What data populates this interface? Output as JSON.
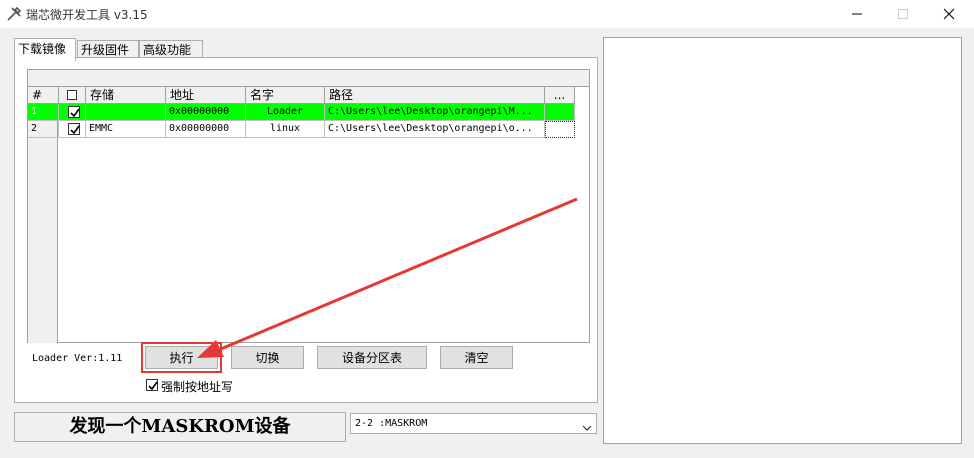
{
  "window": {
    "title": "瑞芯微开发工具 v3.15",
    "icon": "tools-icon"
  },
  "tabs": [
    {
      "label": "下载镜像",
      "active": true
    },
    {
      "label": "升级固件",
      "active": false
    },
    {
      "label": "高级功能",
      "active": false
    }
  ],
  "table": {
    "headers": {
      "num": "#",
      "check": "",
      "storage": "存储",
      "address": "地址",
      "name": "名字",
      "path": "路径",
      "more": "..."
    },
    "rows": [
      {
        "num": "1",
        "checked": true,
        "storage": "",
        "address": "0x00000000",
        "name": "Loader",
        "path": "C:\\Users\\lee\\Desktop\\orangepi\\M...",
        "more": ""
      },
      {
        "num": "2",
        "checked": true,
        "storage": "EMMC",
        "address": "0x00000000",
        "name": "linux",
        "path": "C:\\Users\\lee\\Desktop\\orangepi\\o...",
        "more": ""
      }
    ]
  },
  "loader_version": "Loader Ver:1.11",
  "buttons": {
    "execute": "执行",
    "switch": "切换",
    "partition_table": "设备分区表",
    "clear": "清空"
  },
  "force_address_write": {
    "label": "强制按地址写",
    "checked": true
  },
  "status": "发现一个MASKROM设备",
  "device_select": {
    "value": "2-2 :MASKROM"
  },
  "colors": {
    "loader_row": "#00ff00",
    "highlight": "#e53935"
  }
}
